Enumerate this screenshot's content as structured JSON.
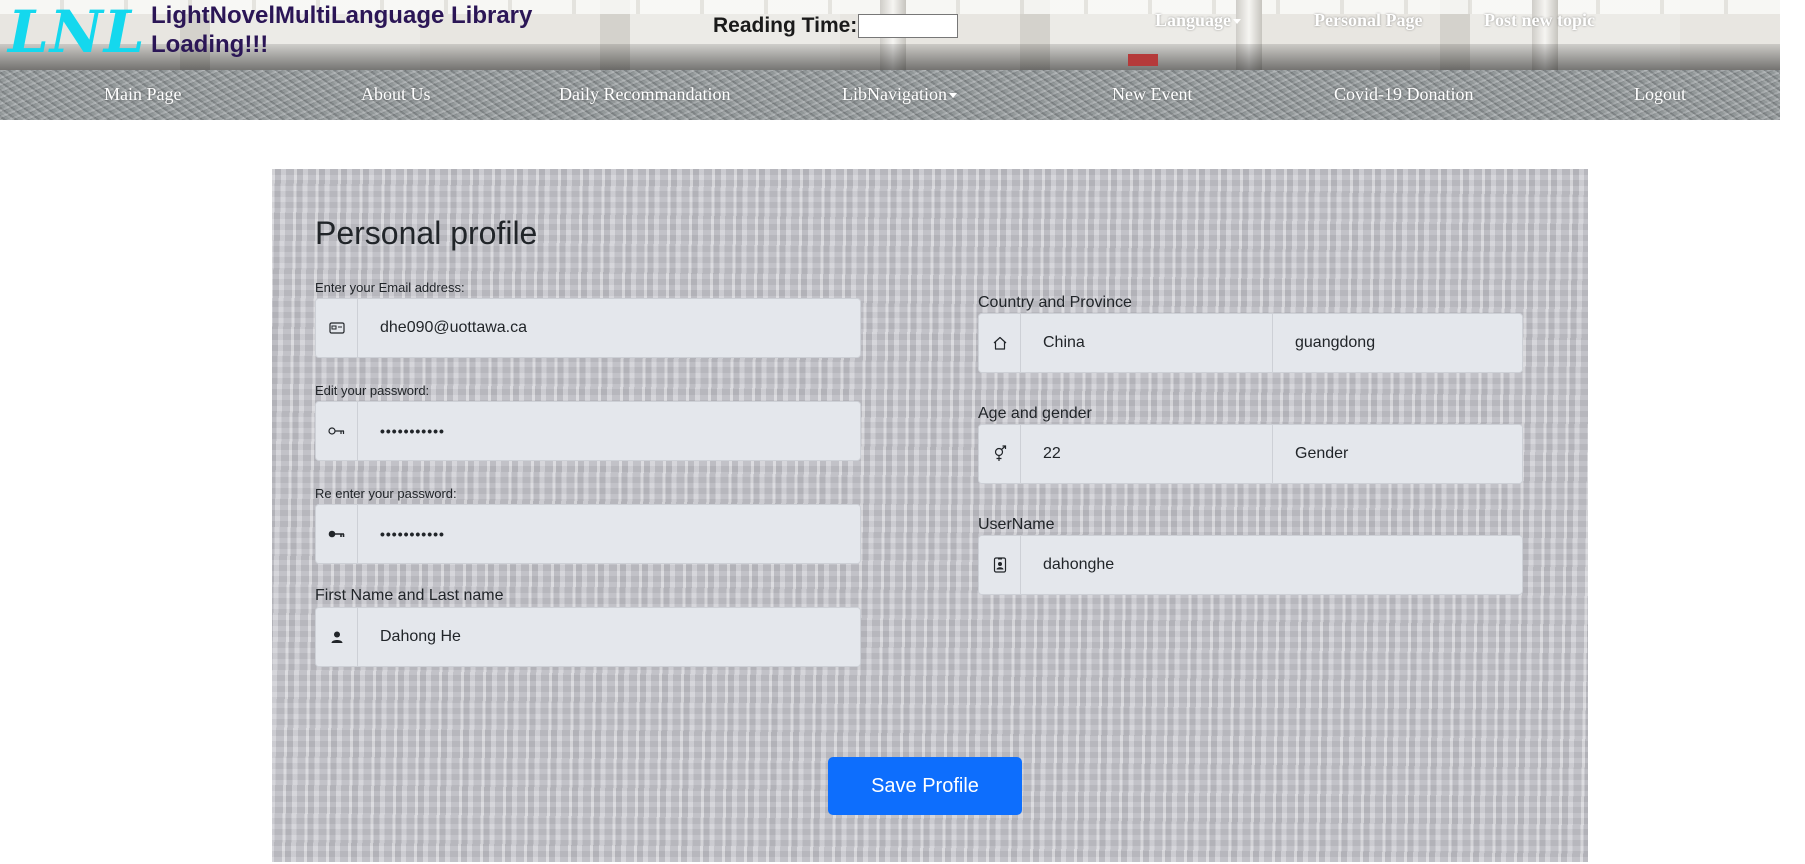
{
  "header": {
    "logo": "LNL",
    "site_title": "LightNovelMultiLanguage Library Loading!!!",
    "reading_time_label": "Reading Time:",
    "reading_time_value": "",
    "links": {
      "language": "Language",
      "personal_page": "Personal Page",
      "post_new_topic": "Post new topic"
    }
  },
  "nav": {
    "main_page": "Main Page",
    "about_us": "About Us",
    "daily_recommendation": "Daily Recommandation",
    "lib_navigation": "LibNavigation",
    "new_event": "New Event",
    "covid_donation": "Covid-19 Donation",
    "logout": "Logout"
  },
  "profile": {
    "title": "Personal profile",
    "email_label": "Enter your Email address:",
    "email_value": "dhe090@uottawa.ca",
    "password_label": "Edit your password:",
    "password_value": "•••••••••••",
    "reenter_label": "Re enter your password:",
    "reenter_value": "•••••••••••",
    "name_label": "First Name and Last name",
    "name_value": "Dahong He",
    "location_label": "Country and Province",
    "country_value": "China",
    "province_value": "guangdong",
    "age_gender_label": "Age and gender",
    "age_value": "22",
    "gender_value": "Gender",
    "username_label": "UserName",
    "username_value": "dahonghe",
    "save_button": "Save Profile"
  },
  "colors": {
    "logo": "#14d8ee",
    "site_title": "#2b1656",
    "primary_button": "#0d6efd",
    "input_background": "#e4e7ec"
  },
  "icons": {
    "email": "card-icon",
    "password": "key-outline-icon",
    "reenter": "key-icon",
    "name": "person-icon",
    "location": "house-icon",
    "gender": "gender-icon",
    "username": "id-badge-icon"
  }
}
